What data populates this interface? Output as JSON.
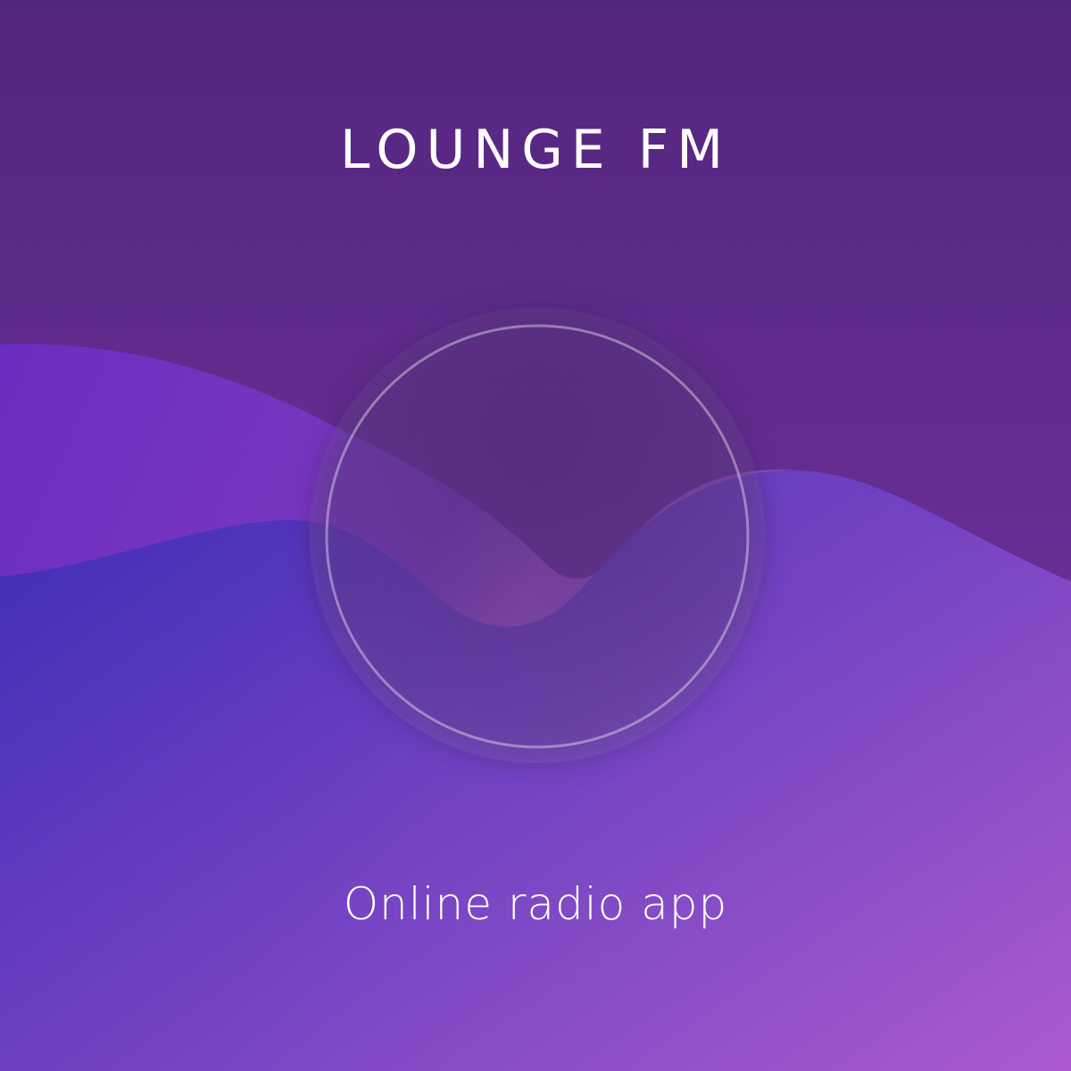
{
  "app": {
    "title": "LOUNGE FM",
    "tagline": "Online radio app"
  },
  "logo": {
    "icon": "wave-circle-logo-icon"
  },
  "colors": {
    "top_background": "#55287f",
    "top_background_light": "#7538a4",
    "wave_back": "#6c2fc0",
    "wave_front_start": "#4630b6",
    "wave_front_end": "#a95bd0",
    "circle_ring": "#ffffff",
    "text": "#ffffff"
  }
}
